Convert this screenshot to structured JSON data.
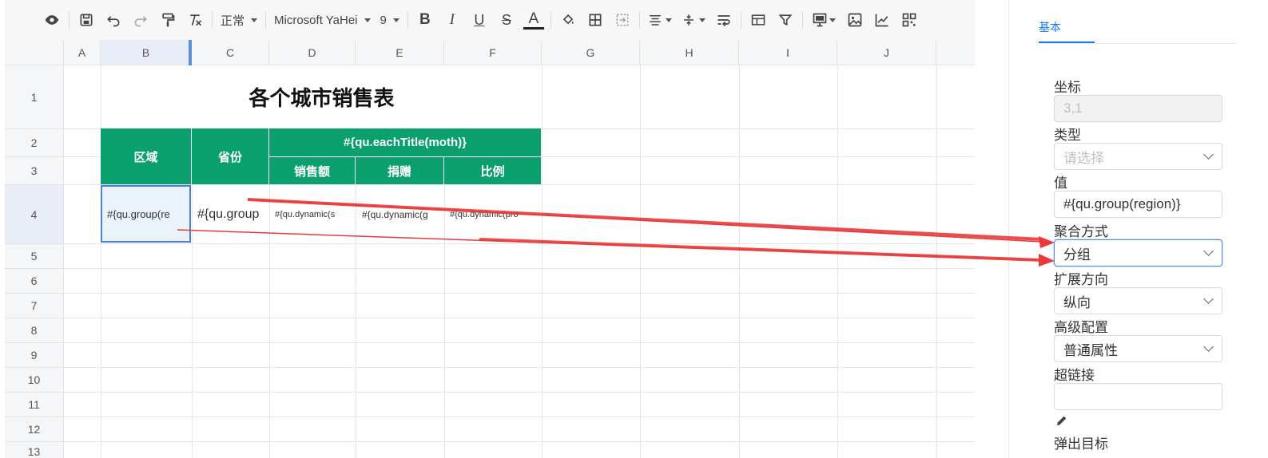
{
  "toolbar": {
    "style_value": "正常",
    "font_value": "Microsoft YaHei",
    "size_value": "9",
    "bold": "B",
    "italic": "I",
    "underline": "U",
    "strike": "S",
    "font_color": "A"
  },
  "columns": [
    "A",
    "B",
    "C",
    "D",
    "E",
    "F",
    "G",
    "H",
    "I",
    "J"
  ],
  "rows": [
    "1",
    "2",
    "3",
    "4",
    "5",
    "6",
    "7",
    "8",
    "9",
    "10",
    "11",
    "12",
    "13"
  ],
  "sheet": {
    "title": "各个城市销售表",
    "header_region": "区域",
    "header_province": "省份",
    "header_each_title": "#{qu.eachTitle(moth)}",
    "header_sales": "销售额",
    "header_donation": "捐赠",
    "header_ratio": "比例",
    "cell_b4": "#{qu.group(re",
    "cell_c4": "#{qu.group",
    "cell_d4": "#{qu.dynamic(s",
    "cell_e4": "#{qu.dynamic(g",
    "cell_f4": "#{qu.dynamic(pro"
  },
  "colors": {
    "header_green": "#0aa06e",
    "accent_blue": "#1677ff",
    "arrow_red": "#e83a3a"
  },
  "panel": {
    "tab_basic": "基本",
    "coord_label": "坐标",
    "coord_value": "3,1",
    "type_label": "类型",
    "type_placeholder": "请选择",
    "value_label": "值",
    "value_value": "#{qu.group(region)}",
    "agg_label": "聚合方式",
    "agg_value": "分组",
    "expand_label": "扩展方向",
    "expand_value": "纵向",
    "advanced_label": "高级配置",
    "advanced_value": "普通属性",
    "link_label": "超链接",
    "link_value": "",
    "popup_label": "弹出目标"
  }
}
